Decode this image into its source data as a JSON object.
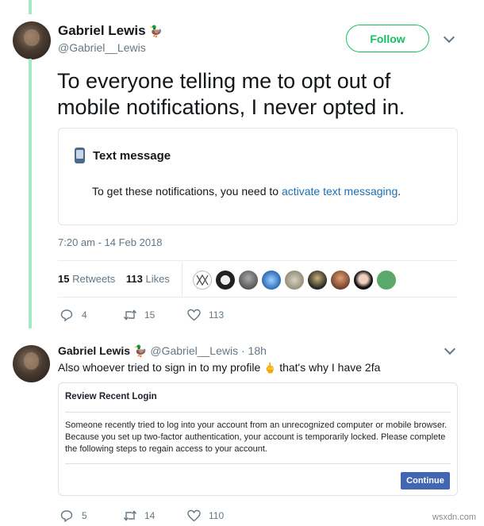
{
  "tweet": {
    "author_name": "Gabriel Lewis",
    "author_handle": "@Gabriel__Lewis",
    "follow_label": "Follow",
    "text": "To everyone telling me to opt out of mobile notifications, I never opted in.",
    "card": {
      "title": "Text message",
      "message_prefix": "To get these notifications, you need to ",
      "message_link": "activate text messaging",
      "message_suffix": "."
    },
    "timestamp": "7:20 am - 14 Feb 2018",
    "retweets_count": "15",
    "retweets_label": "Retweets",
    "likes_count": "113",
    "likes_label": "Likes",
    "actions": {
      "reply_count": "4",
      "retweet_count": "15",
      "like_count": "113"
    }
  },
  "reply": {
    "author_name": "Gabriel Lewis",
    "author_handle": "@Gabriel__Lewis",
    "time": "18h",
    "text_before": "Also whoever tried to sign in to my profile ",
    "text_after": " that's why I have 2fa",
    "card": {
      "title": "Review Recent Login",
      "body": "Someone recently tried to log into your account from an unrecognized computer or mobile browser. Because you set up two-factor authentication, your account is temporarily locked. Please complete the following steps to regain access to your account.",
      "button_label": "Continue"
    },
    "actions": {
      "reply_count": "5",
      "retweet_count": "14",
      "like_count": "110"
    }
  },
  "watermark": "wsxdn.com",
  "colors": {
    "thread_line": "#a6e8c4",
    "follow_green": "#17bf63",
    "link_blue": "#1b6fb5",
    "fb_blue": "#4267b2"
  }
}
